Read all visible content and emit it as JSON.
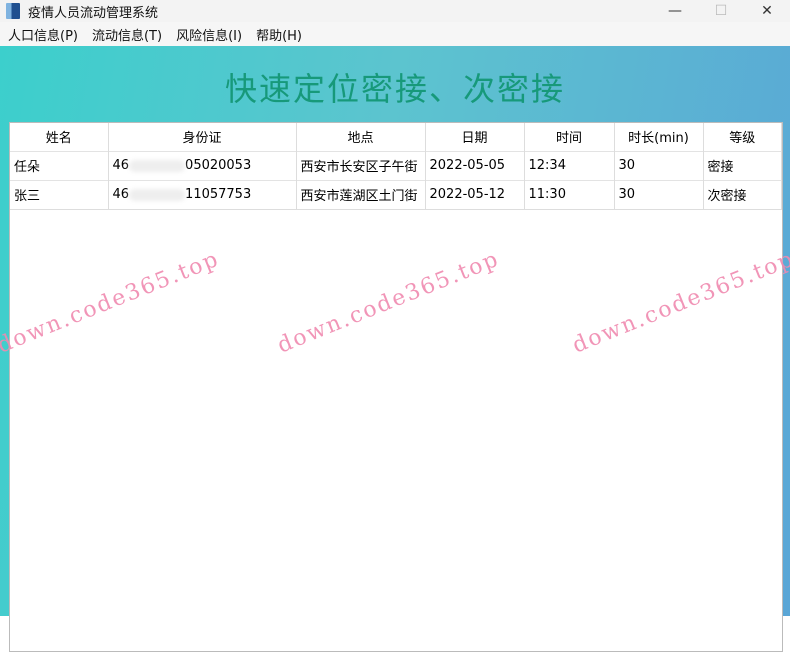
{
  "window": {
    "title": "疫情人员流动管理系统",
    "minimize": "—",
    "maximize": "☐",
    "close": "✕"
  },
  "menu": [
    "人口信息(P)",
    "流动信息(T)",
    "风险信息(I)",
    "帮助(H)"
  ],
  "heading": "快速定位密接、次密接",
  "table": {
    "columns": [
      "姓名",
      "身份证",
      "地点",
      "日期",
      "时间",
      "时长(min)",
      "等级"
    ],
    "rows": [
      {
        "name": "任朵",
        "id_prefix": "46",
        "id_suffix": "05020053",
        "place": "西安市长安区子午街",
        "date": "2022-05-05",
        "time": "12:34",
        "duration": "30",
        "level": "密接"
      },
      {
        "name": "张三",
        "id_prefix": "46",
        "id_suffix": "11057753",
        "place": "西安市莲湖区土门街",
        "date": "2022-05-12",
        "time": "11:30",
        "duration": "30",
        "level": "次密接"
      }
    ]
  },
  "watermark": "down.code365.top"
}
